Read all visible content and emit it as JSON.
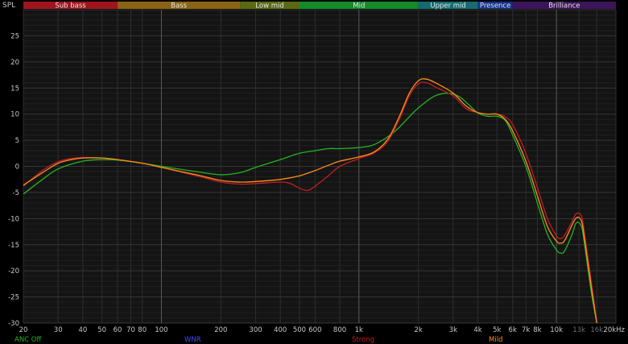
{
  "chart_data": {
    "type": "line",
    "title": "",
    "ylabel": "SPL",
    "xlabel": "",
    "x_scale": "log",
    "xlim": [
      20,
      20000
    ],
    "ylim": [
      -30,
      30
    ],
    "grid": true,
    "bands": [
      {
        "label": "Sub bass",
        "from": 20,
        "to": 60,
        "color": "#a0141c"
      },
      {
        "label": "Bass",
        "from": 60,
        "to": 250,
        "color": "#8a6414"
      },
      {
        "label": "Low mid",
        "from": 250,
        "to": 500,
        "color": "#5a6a14"
      },
      {
        "label": "Mid",
        "from": 500,
        "to": 2000,
        "color": "#148a2a"
      },
      {
        "label": "Upper mid",
        "from": 2000,
        "to": 4000,
        "color": "#146c70"
      },
      {
        "label": "Presence",
        "from": 4000,
        "to": 6000,
        "color": "#14328a"
      },
      {
        "label": "Brilliance",
        "from": 6000,
        "to": 20000,
        "color": "#3c145a"
      }
    ],
    "y_ticks": [
      25,
      20,
      15,
      10,
      5,
      0,
      -5,
      -10,
      -15,
      -20,
      -25,
      -30
    ],
    "x_ticks": [
      {
        "value": 20,
        "label": "20"
      },
      {
        "value": 30,
        "label": "30"
      },
      {
        "value": 40,
        "label": "40"
      },
      {
        "value": 50,
        "label": "50"
      },
      {
        "value": 60,
        "label": "60"
      },
      {
        "value": 70,
        "label": "70"
      },
      {
        "value": 80,
        "label": "80"
      },
      {
        "value": 100,
        "label": "100"
      },
      {
        "value": 200,
        "label": "200"
      },
      {
        "value": 300,
        "label": "300"
      },
      {
        "value": 400,
        "label": "400"
      },
      {
        "value": 500,
        "label": "500"
      },
      {
        "value": 600,
        "label": "600"
      },
      {
        "value": 800,
        "label": "800"
      },
      {
        "value": 1000,
        "label": "1k"
      },
      {
        "value": 2000,
        "label": "2k"
      },
      {
        "value": 3000,
        "label": "3k"
      },
      {
        "value": 4000,
        "label": "4k"
      },
      {
        "value": 5000,
        "label": "5k"
      },
      {
        "value": 6000,
        "label": "6k"
      },
      {
        "value": 7000,
        "label": "7k"
      },
      {
        "value": 8000,
        "label": "8k"
      },
      {
        "value": 10000,
        "label": "10k"
      },
      {
        "value": 13000,
        "label": "13k"
      },
      {
        "value": 16000,
        "label": "16k"
      },
      {
        "value": 20000,
        "label": "20kHz"
      }
    ],
    "bright_x_lines": [
      100,
      1000,
      10000
    ],
    "dim_x_labels": [
      13000,
      16000
    ],
    "series": [
      {
        "name": "ANC Off",
        "color": "#22b422",
        "points": [
          [
            20,
            -5.3
          ],
          [
            25,
            -2.5
          ],
          [
            30,
            -0.5
          ],
          [
            40,
            1.0
          ],
          [
            50,
            1.3
          ],
          [
            60,
            1.2
          ],
          [
            80,
            0.6
          ],
          [
            100,
            0.0
          ],
          [
            150,
            -1.0
          ],
          [
            200,
            -1.6
          ],
          [
            250,
            -1.2
          ],
          [
            300,
            -0.2
          ],
          [
            400,
            1.3
          ],
          [
            500,
            2.5
          ],
          [
            600,
            3.0
          ],
          [
            700,
            3.4
          ],
          [
            800,
            3.4
          ],
          [
            1000,
            3.6
          ],
          [
            1200,
            4.2
          ],
          [
            1500,
            6.5
          ],
          [
            1800,
            9.5
          ],
          [
            2000,
            11.2
          ],
          [
            2400,
            13.4
          ],
          [
            2800,
            14.0
          ],
          [
            3200,
            13.4
          ],
          [
            3600,
            11.8
          ],
          [
            4000,
            10.2
          ],
          [
            4500,
            9.6
          ],
          [
            5000,
            9.6
          ],
          [
            5500,
            8.8
          ],
          [
            6000,
            6.0
          ],
          [
            7000,
            0.0
          ],
          [
            8000,
            -7.0
          ],
          [
            9000,
            -13.0
          ],
          [
            10000,
            -16.0
          ],
          [
            10500,
            -16.6
          ],
          [
            11000,
            -16.2
          ],
          [
            12000,
            -13.0
          ],
          [
            12500,
            -11.0
          ],
          [
            13000,
            -10.8
          ],
          [
            13500,
            -12.0
          ],
          [
            14000,
            -16.0
          ],
          [
            15000,
            -24.0
          ],
          [
            16000,
            -30.0
          ]
        ]
      },
      {
        "name": "WNR",
        "color": "#4646ff",
        "points": []
      },
      {
        "name": "Strong",
        "color": "#c41e24",
        "points": [
          [
            20,
            -3.8
          ],
          [
            25,
            -0.8
          ],
          [
            30,
            0.9
          ],
          [
            35,
            1.5
          ],
          [
            40,
            1.7
          ],
          [
            50,
            1.6
          ],
          [
            60,
            1.3
          ],
          [
            80,
            0.6
          ],
          [
            100,
            -0.2
          ],
          [
            150,
            -1.8
          ],
          [
            200,
            -3.0
          ],
          [
            250,
            -3.4
          ],
          [
            300,
            -3.3
          ],
          [
            400,
            -3.0
          ],
          [
            450,
            -3.3
          ],
          [
            500,
            -4.2
          ],
          [
            550,
            -4.6
          ],
          [
            600,
            -3.8
          ],
          [
            700,
            -1.8
          ],
          [
            800,
            0.0
          ],
          [
            1000,
            1.5
          ],
          [
            1200,
            2.6
          ],
          [
            1400,
            4.8
          ],
          [
            1600,
            9.0
          ],
          [
            1800,
            13.5
          ],
          [
            2000,
            15.8
          ],
          [
            2200,
            16.0
          ],
          [
            2500,
            15.0
          ],
          [
            3000,
            13.5
          ],
          [
            3500,
            11.0
          ],
          [
            4000,
            10.3
          ],
          [
            4500,
            10.0
          ],
          [
            5000,
            10.0
          ],
          [
            5500,
            9.5
          ],
          [
            6000,
            8.0
          ],
          [
            7000,
            2.5
          ],
          [
            8000,
            -4.0
          ],
          [
            9000,
            -10.0
          ],
          [
            10000,
            -13.3
          ],
          [
            10500,
            -13.8
          ],
          [
            11000,
            -13.2
          ],
          [
            12000,
            -10.5
          ],
          [
            12500,
            -9.2
          ],
          [
            13000,
            -9.0
          ],
          [
            13500,
            -10.0
          ],
          [
            14000,
            -14.0
          ],
          [
            15000,
            -22.0
          ],
          [
            16000,
            -30.0
          ]
        ]
      },
      {
        "name": "Mild",
        "color": "#ff8c1e",
        "points": [
          [
            20,
            -3.6
          ],
          [
            25,
            -1.2
          ],
          [
            30,
            0.6
          ],
          [
            35,
            1.3
          ],
          [
            40,
            1.6
          ],
          [
            50,
            1.6
          ],
          [
            60,
            1.3
          ],
          [
            80,
            0.6
          ],
          [
            100,
            -0.2
          ],
          [
            150,
            -1.6
          ],
          [
            200,
            -2.7
          ],
          [
            250,
            -3.0
          ],
          [
            300,
            -2.9
          ],
          [
            400,
            -2.5
          ],
          [
            500,
            -1.8
          ],
          [
            600,
            -0.8
          ],
          [
            700,
            0.2
          ],
          [
            800,
            1.0
          ],
          [
            1000,
            1.8
          ],
          [
            1200,
            2.8
          ],
          [
            1400,
            5.2
          ],
          [
            1600,
            9.5
          ],
          [
            1800,
            14.0
          ],
          [
            2000,
            16.4
          ],
          [
            2200,
            16.7
          ],
          [
            2500,
            15.8
          ],
          [
            3000,
            14.0
          ],
          [
            3500,
            11.5
          ],
          [
            4000,
            10.3
          ],
          [
            4500,
            10.0
          ],
          [
            5000,
            10.0
          ],
          [
            5500,
            9.0
          ],
          [
            6000,
            6.8
          ],
          [
            7000,
            1.0
          ],
          [
            8000,
            -5.6
          ],
          [
            9000,
            -11.5
          ],
          [
            10000,
            -14.3
          ],
          [
            10500,
            -14.7
          ],
          [
            11000,
            -14.2
          ],
          [
            12000,
            -11.2
          ],
          [
            12500,
            -10.0
          ],
          [
            13000,
            -9.8
          ],
          [
            13500,
            -11.0
          ],
          [
            14000,
            -15.0
          ],
          [
            15000,
            -23.0
          ],
          [
            16000,
            -30.0
          ]
        ]
      }
    ]
  }
}
